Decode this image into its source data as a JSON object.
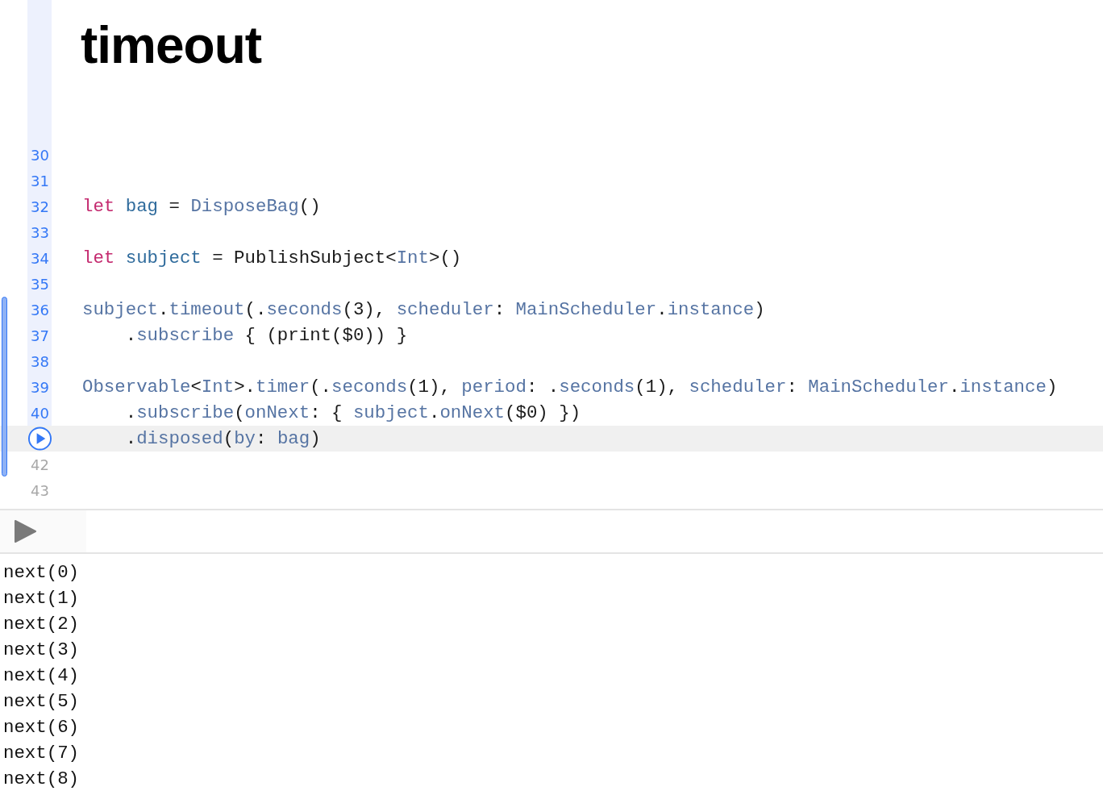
{
  "document": {
    "title": "timeout"
  },
  "editor": {
    "lines": [
      {
        "number": "30",
        "executed": true,
        "current": false
      },
      {
        "number": "31",
        "executed": true,
        "current": false
      },
      {
        "number": "32",
        "executed": true,
        "current": false,
        "tokens": [
          {
            "kind": "keyword",
            "text": "let"
          },
          {
            "kind": "decl",
            "text": "bag"
          },
          {
            "kind": "plain",
            "text": " = "
          },
          {
            "kind": "member",
            "text": "DisposeBag"
          },
          {
            "kind": "plain",
            "text": "()"
          }
        ]
      },
      {
        "number": "33",
        "executed": true,
        "current": false
      },
      {
        "number": "34",
        "executed": true,
        "current": false,
        "tokens": [
          {
            "kind": "keyword",
            "text": "let"
          },
          {
            "kind": "decl",
            "text": "subject"
          },
          {
            "kind": "plain",
            "text": " = PublishSubject<"
          },
          {
            "kind": "member",
            "text": "Int"
          },
          {
            "kind": "plain",
            "text": ">()"
          }
        ]
      },
      {
        "number": "35",
        "executed": true,
        "current": false
      },
      {
        "number": "36",
        "executed": true,
        "current": false,
        "tokens": [
          {
            "kind": "member",
            "text": "subject"
          },
          {
            "kind": "plain",
            "text": "."
          },
          {
            "kind": "member",
            "text": "timeout"
          },
          {
            "kind": "plain",
            "text": "(."
          },
          {
            "kind": "member",
            "text": "seconds"
          },
          {
            "kind": "plain",
            "text": "(3), "
          },
          {
            "kind": "member",
            "text": "scheduler"
          },
          {
            "kind": "plain",
            "text": ": "
          },
          {
            "kind": "member",
            "text": "MainScheduler"
          },
          {
            "kind": "plain",
            "text": "."
          },
          {
            "kind": "member",
            "text": "instance"
          },
          {
            "kind": "plain",
            "text": ")"
          }
        ]
      },
      {
        "number": "37",
        "executed": true,
        "current": false,
        "tokens": [
          {
            "kind": "plain",
            "text": "    ."
          },
          {
            "kind": "member",
            "text": "subscribe"
          },
          {
            "kind": "plain",
            "text": " { (print($0)) }"
          }
        ]
      },
      {
        "number": "38",
        "executed": true,
        "current": false
      },
      {
        "number": "39",
        "executed": true,
        "current": false,
        "tokens": [
          {
            "kind": "member",
            "text": "Observable"
          },
          {
            "kind": "plain",
            "text": "<"
          },
          {
            "kind": "member",
            "text": "Int"
          },
          {
            "kind": "plain",
            "text": ">."
          },
          {
            "kind": "member",
            "text": "timer"
          },
          {
            "kind": "plain",
            "text": "(."
          },
          {
            "kind": "member",
            "text": "seconds"
          },
          {
            "kind": "plain",
            "text": "(1), "
          },
          {
            "kind": "member",
            "text": "period"
          },
          {
            "kind": "plain",
            "text": ": ."
          },
          {
            "kind": "member",
            "text": "seconds"
          },
          {
            "kind": "plain",
            "text": "(1), "
          },
          {
            "kind": "member",
            "text": "scheduler"
          },
          {
            "kind": "plain",
            "text": ": "
          },
          {
            "kind": "member",
            "text": "MainScheduler"
          },
          {
            "kind": "plain",
            "text": "."
          },
          {
            "kind": "member",
            "text": "instance"
          },
          {
            "kind": "plain",
            "text": ")"
          }
        ]
      },
      {
        "number": "40",
        "executed": true,
        "current": false,
        "tokens": [
          {
            "kind": "plain",
            "text": "    ."
          },
          {
            "kind": "member",
            "text": "subscribe"
          },
          {
            "kind": "plain",
            "text": "("
          },
          {
            "kind": "member",
            "text": "onNext"
          },
          {
            "kind": "plain",
            "text": ": { "
          },
          {
            "kind": "member",
            "text": "subject"
          },
          {
            "kind": "plain",
            "text": "."
          },
          {
            "kind": "member",
            "text": "onNext"
          },
          {
            "kind": "plain",
            "text": "($0) })"
          }
        ]
      },
      {
        "executed": false,
        "current": true,
        "tokens": [
          {
            "kind": "plain",
            "text": "    ."
          },
          {
            "kind": "member",
            "text": "disposed"
          },
          {
            "kind": "plain",
            "text": "("
          },
          {
            "kind": "member",
            "text": "by"
          },
          {
            "kind": "plain",
            "text": ": "
          },
          {
            "kind": "member",
            "text": "bag"
          },
          {
            "kind": "plain",
            "text": ")"
          }
        ]
      },
      {
        "number": "42",
        "executed": false,
        "current": false
      },
      {
        "number": "43",
        "executed": false,
        "current": false
      }
    ]
  },
  "console": {
    "lines": [
      "next(0)",
      "next(1)",
      "next(2)",
      "next(3)",
      "next(4)",
      "next(5)",
      "next(6)",
      "next(7)",
      "next(8)"
    ]
  }
}
